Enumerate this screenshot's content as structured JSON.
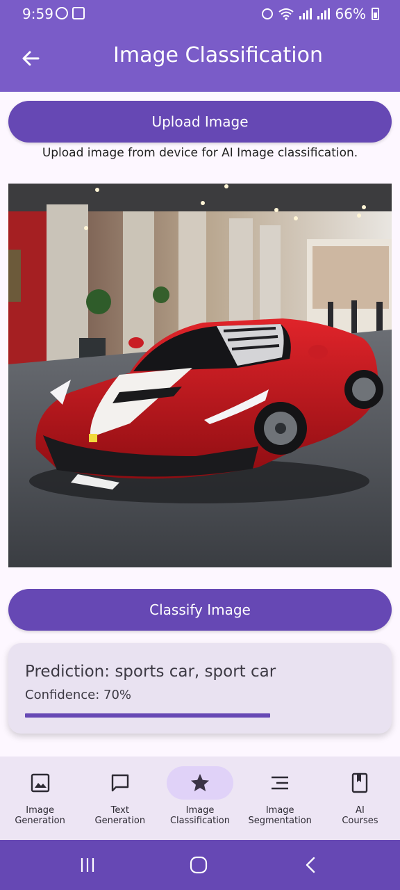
{
  "status_bar": {
    "time": "9:59",
    "battery": "66%"
  },
  "app_bar": {
    "title": "Image Classification"
  },
  "upload": {
    "button_label": "Upload Image",
    "hint": "Upload image from device for AI Image classification."
  },
  "image": {
    "alt": "Red and white sports car parked in a showroom"
  },
  "classify": {
    "button_label": "Classify Image"
  },
  "result": {
    "prediction": "Prediction: sports car, sport car",
    "confidence": "Confidence: 70%",
    "confidence_value": 0.7
  },
  "bottom_nav": {
    "items": [
      {
        "label": "Image\nGeneration",
        "icon": "image-icon",
        "active": false
      },
      {
        "label": "Text\nGeneration",
        "icon": "chat-icon",
        "active": false
      },
      {
        "label": "Image\nClassification",
        "icon": "star-icon",
        "active": true
      },
      {
        "label": "Image\nSegmentation",
        "icon": "segment-lines-icon",
        "active": false
      },
      {
        "label": "AI\nCourses",
        "icon": "book-icon",
        "active": false
      }
    ]
  },
  "colors": {
    "primary": "#6648b4",
    "app_bar": "#7a5cc8",
    "card": "#e9e2f1",
    "nav_bg": "#ede5f4",
    "active_pill": "#e0d2f8"
  }
}
